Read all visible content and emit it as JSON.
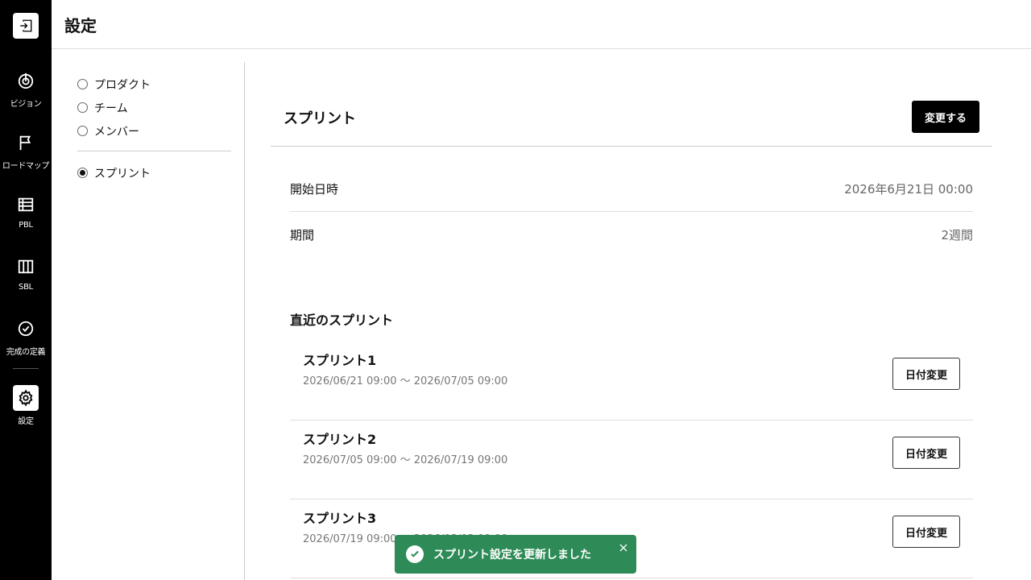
{
  "app": {
    "logo_icon": "exit-arrow-icon"
  },
  "rail": {
    "items": [
      {
        "label": "ビジョン",
        "icon": "target-icon"
      },
      {
        "label": "ロードマップ",
        "icon": "flag-icon"
      },
      {
        "label": "PBL",
        "icon": "list-icon"
      },
      {
        "label": "SBL",
        "icon": "columns-icon"
      },
      {
        "label": "完成の定義",
        "icon": "check-circle-icon"
      },
      {
        "label": "設定",
        "icon": "gear-icon",
        "active": true
      }
    ]
  },
  "header": {
    "title": "設定"
  },
  "settings_nav": {
    "items": [
      {
        "label": "プロダクト",
        "checked": false
      },
      {
        "label": "チーム",
        "checked": false
      },
      {
        "label": "メンバー",
        "checked": false
      },
      {
        "label": "スプリント",
        "checked": true
      }
    ]
  },
  "section": {
    "title": "スプリント",
    "change_button": "変更する",
    "fields": [
      {
        "label": "開始日時",
        "value": "2026年6月21日 00:00"
      },
      {
        "label": "期間",
        "value": "2週間"
      }
    ]
  },
  "recent": {
    "title": "直近のスプリント",
    "button_label": "日付変更",
    "sprints": [
      {
        "name": "スプリント1",
        "range": "2026/06/21 09:00 〜 2026/07/05 09:00"
      },
      {
        "name": "スプリント2",
        "range": "2026/07/05 09:00 〜 2026/07/19 09:00"
      },
      {
        "name": "スプリント3",
        "range": "2026/07/19 09:00 〜 2026/08/02 09:00"
      }
    ]
  },
  "toast": {
    "message": "スプリント設定を更新しました",
    "color": "#2e8b57"
  }
}
